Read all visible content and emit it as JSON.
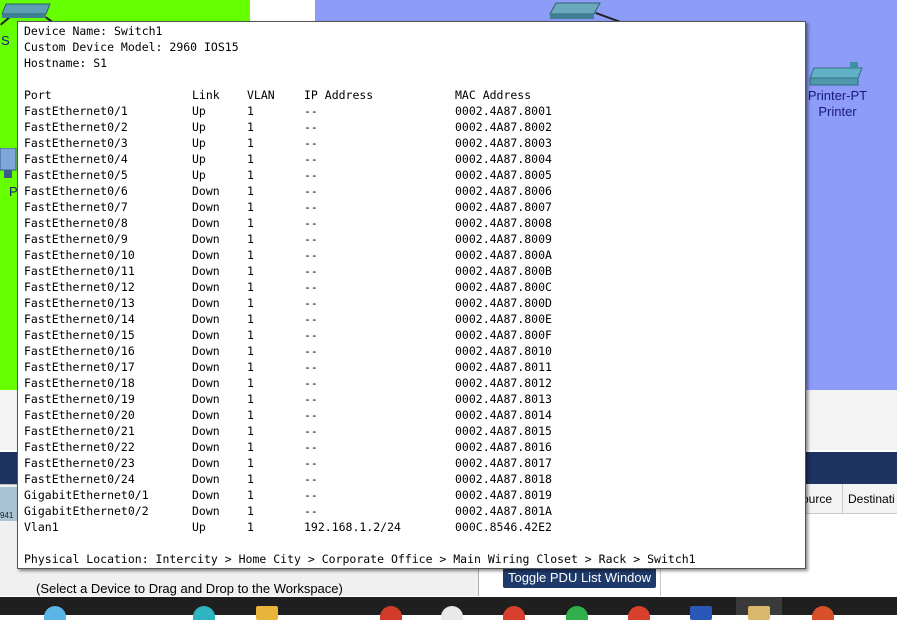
{
  "workspace": {
    "printer_label_line1": "Printer-PT",
    "printer_label_line2": "Printer",
    "pc_label_fragment": "P",
    "switch_label_fragment1": "Sw",
    "switch_label_fragment2": "S"
  },
  "tooltip": {
    "device_name": "Device Name: Switch1",
    "device_model": "Custom Device Model: 2960 IOS15",
    "hostname": "Hostname: S1",
    "headers": {
      "port": "Port",
      "link": "Link",
      "vlan": "VLAN",
      "ip": "IP Address",
      "mac": "MAC Address"
    },
    "rows": [
      {
        "port": "FastEthernet0/1",
        "link": "Up",
        "vlan": "1",
        "ip": "--",
        "mac": "0002.4A87.8001"
      },
      {
        "port": "FastEthernet0/2",
        "link": "Up",
        "vlan": "1",
        "ip": "--",
        "mac": "0002.4A87.8002"
      },
      {
        "port": "FastEthernet0/3",
        "link": "Up",
        "vlan": "1",
        "ip": "--",
        "mac": "0002.4A87.8003"
      },
      {
        "port": "FastEthernet0/4",
        "link": "Up",
        "vlan": "1",
        "ip": "--",
        "mac": "0002.4A87.8004"
      },
      {
        "port": "FastEthernet0/5",
        "link": "Up",
        "vlan": "1",
        "ip": "--",
        "mac": "0002.4A87.8005"
      },
      {
        "port": "FastEthernet0/6",
        "link": "Down",
        "vlan": "1",
        "ip": "--",
        "mac": "0002.4A87.8006"
      },
      {
        "port": "FastEthernet0/7",
        "link": "Down",
        "vlan": "1",
        "ip": "--",
        "mac": "0002.4A87.8007"
      },
      {
        "port": "FastEthernet0/8",
        "link": "Down",
        "vlan": "1",
        "ip": "--",
        "mac": "0002.4A87.8008"
      },
      {
        "port": "FastEthernet0/9",
        "link": "Down",
        "vlan": "1",
        "ip": "--",
        "mac": "0002.4A87.8009"
      },
      {
        "port": "FastEthernet0/10",
        "link": "Down",
        "vlan": "1",
        "ip": "--",
        "mac": "0002.4A87.800A"
      },
      {
        "port": "FastEthernet0/11",
        "link": "Down",
        "vlan": "1",
        "ip": "--",
        "mac": "0002.4A87.800B"
      },
      {
        "port": "FastEthernet0/12",
        "link": "Down",
        "vlan": "1",
        "ip": "--",
        "mac": "0002.4A87.800C"
      },
      {
        "port": "FastEthernet0/13",
        "link": "Down",
        "vlan": "1",
        "ip": "--",
        "mac": "0002.4A87.800D"
      },
      {
        "port": "FastEthernet0/14",
        "link": "Down",
        "vlan": "1",
        "ip": "--",
        "mac": "0002.4A87.800E"
      },
      {
        "port": "FastEthernet0/15",
        "link": "Down",
        "vlan": "1",
        "ip": "--",
        "mac": "0002.4A87.800F"
      },
      {
        "port": "FastEthernet0/16",
        "link": "Down",
        "vlan": "1",
        "ip": "--",
        "mac": "0002.4A87.8010"
      },
      {
        "port": "FastEthernet0/17",
        "link": "Down",
        "vlan": "1",
        "ip": "--",
        "mac": "0002.4A87.8011"
      },
      {
        "port": "FastEthernet0/18",
        "link": "Down",
        "vlan": "1",
        "ip": "--",
        "mac": "0002.4A87.8012"
      },
      {
        "port": "FastEthernet0/19",
        "link": "Down",
        "vlan": "1",
        "ip": "--",
        "mac": "0002.4A87.8013"
      },
      {
        "port": "FastEthernet0/20",
        "link": "Down",
        "vlan": "1",
        "ip": "--",
        "mac": "0002.4A87.8014"
      },
      {
        "port": "FastEthernet0/21",
        "link": "Down",
        "vlan": "1",
        "ip": "--",
        "mac": "0002.4A87.8015"
      },
      {
        "port": "FastEthernet0/22",
        "link": "Down",
        "vlan": "1",
        "ip": "--",
        "mac": "0002.4A87.8016"
      },
      {
        "port": "FastEthernet0/23",
        "link": "Down",
        "vlan": "1",
        "ip": "--",
        "mac": "0002.4A87.8017"
      },
      {
        "port": "FastEthernet0/24",
        "link": "Down",
        "vlan": "1",
        "ip": "--",
        "mac": "0002.4A87.8018"
      },
      {
        "port": "GigabitEthernet0/1",
        "link": "Down",
        "vlan": "1",
        "ip": "--",
        "mac": "0002.4A87.8019"
      },
      {
        "port": "GigabitEthernet0/2",
        "link": "Down",
        "vlan": "1",
        "ip": "--",
        "mac": "0002.4A87.801A"
      },
      {
        "port": "Vlan1",
        "link": "Up",
        "vlan": "1",
        "ip": "192.168.1.2/24",
        "mac": "000C.8546.42E2"
      }
    ],
    "physical_location": "Physical Location: Intercity > Home City > Corporate Office > Main Wiring Closet > Rack > Switch1"
  },
  "pdu_panel": {
    "col_source": "Source",
    "col_destination": "Destinati",
    "toggle_label": "Toggle PDU List Window"
  },
  "device_panel": {
    "hint": "(Select a Device to Drag and Drop to the Workspace)",
    "mini_device_label": "941"
  },
  "colors": {
    "workspace_green": "#66ff00",
    "workspace_blue": "#8c9cf7",
    "panel_navy": "#1d3460"
  }
}
